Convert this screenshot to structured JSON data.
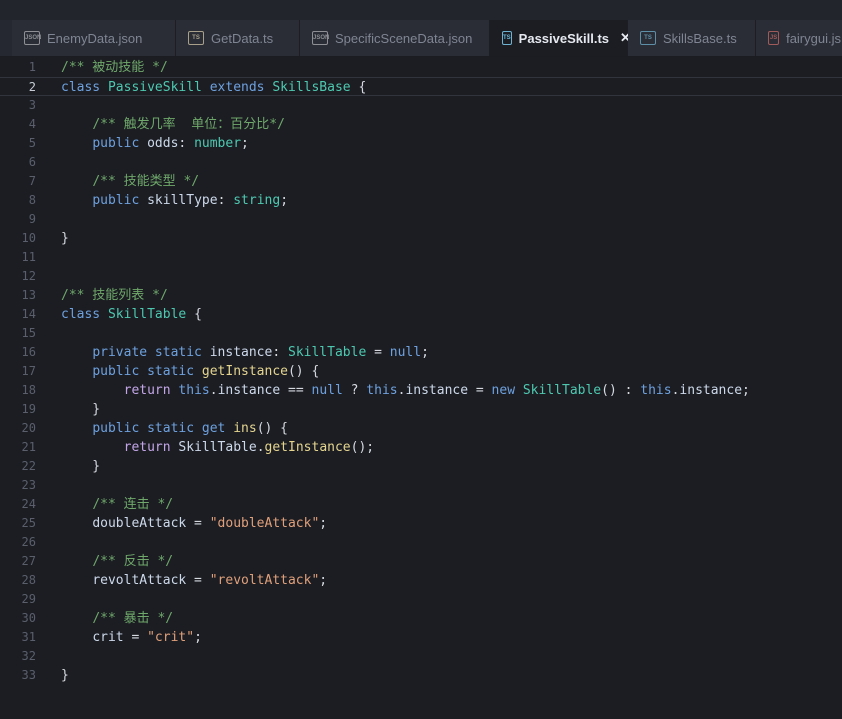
{
  "tabs": [
    {
      "label": "EnemyData.json",
      "icon": "json-file-icon",
      "badge": "JSON",
      "color": "#8d8f95"
    },
    {
      "label": "GetData.ts",
      "icon": "ts-file-icon",
      "badge": "TS",
      "color": "#a8a08a"
    },
    {
      "label": "SpecificSceneData.json",
      "icon": "json-file-icon",
      "badge": "JSON",
      "color": "#8d8f95"
    },
    {
      "label": "PassiveSkill.ts",
      "icon": "ts-file-icon",
      "badge": "TS",
      "color": "#6fb3d2",
      "active": true,
      "close": "✕"
    },
    {
      "label": "SkillsBase.ts",
      "icon": "ts-file-icon",
      "badge": "TS",
      "color": "#5e8fa8"
    },
    {
      "label": "fairygui.js",
      "icon": "js-file-icon",
      "badge": "JS",
      "color": "#a05a5a"
    }
  ],
  "editor": {
    "current_line": 2,
    "lines": [
      {
        "n": "1",
        "tokens": [
          {
            "t": "c",
            "v": "/** 被动技能 */"
          }
        ]
      },
      {
        "n": "2",
        "tokens": [
          {
            "t": "k",
            "v": "class "
          },
          {
            "t": "cls",
            "v": "PassiveSkill "
          },
          {
            "t": "k",
            "v": "extends "
          },
          {
            "t": "cls",
            "v": "SkillsBase "
          },
          {
            "t": "",
            "v": "{"
          }
        ]
      },
      {
        "n": "3",
        "tokens": []
      },
      {
        "n": "4",
        "tokens": [
          {
            "t": "",
            "v": "    "
          },
          {
            "t": "c",
            "v": "/** 触发几率  单位：百分比*/"
          }
        ]
      },
      {
        "n": "5",
        "tokens": [
          {
            "t": "",
            "v": "    "
          },
          {
            "t": "k",
            "v": "public "
          },
          {
            "t": "v",
            "v": "odds"
          },
          {
            "t": "",
            "v": ": "
          },
          {
            "t": "cls",
            "v": "number"
          },
          {
            "t": "",
            "v": ";"
          }
        ]
      },
      {
        "n": "6",
        "tokens": []
      },
      {
        "n": "7",
        "tokens": [
          {
            "t": "",
            "v": "    "
          },
          {
            "t": "c",
            "v": "/** 技能类型 */"
          }
        ]
      },
      {
        "n": "8",
        "tokens": [
          {
            "t": "",
            "v": "    "
          },
          {
            "t": "k",
            "v": "public "
          },
          {
            "t": "v",
            "v": "skillType"
          },
          {
            "t": "",
            "v": ": "
          },
          {
            "t": "cls",
            "v": "string"
          },
          {
            "t": "",
            "v": ";"
          }
        ]
      },
      {
        "n": "9",
        "tokens": []
      },
      {
        "n": "10",
        "tokens": [
          {
            "t": "",
            "v": "}"
          }
        ]
      },
      {
        "n": "11",
        "tokens": []
      },
      {
        "n": "12",
        "tokens": []
      },
      {
        "n": "13",
        "tokens": [
          {
            "t": "c",
            "v": "/** 技能列表 */"
          }
        ]
      },
      {
        "n": "14",
        "tokens": [
          {
            "t": "k",
            "v": "class "
          },
          {
            "t": "cls",
            "v": "SkillTable "
          },
          {
            "t": "",
            "v": "{"
          }
        ]
      },
      {
        "n": "15",
        "tokens": []
      },
      {
        "n": "16",
        "tokens": [
          {
            "t": "",
            "v": "    "
          },
          {
            "t": "k",
            "v": "private static "
          },
          {
            "t": "v",
            "v": "instance"
          },
          {
            "t": "",
            "v": ": "
          },
          {
            "t": "cls",
            "v": "SkillTable"
          },
          {
            "t": "",
            "v": " = "
          },
          {
            "t": "k",
            "v": "null"
          },
          {
            "t": "",
            "v": ";"
          }
        ]
      },
      {
        "n": "17",
        "tokens": [
          {
            "t": "",
            "v": "    "
          },
          {
            "t": "k",
            "v": "public static "
          },
          {
            "t": "fn",
            "v": "getInstance"
          },
          {
            "t": "",
            "v": "() {"
          }
        ]
      },
      {
        "n": "18",
        "tokens": [
          {
            "t": "",
            "v": "        "
          },
          {
            "t": "p",
            "v": "return "
          },
          {
            "t": "k",
            "v": "this"
          },
          {
            "t": "",
            "v": "."
          },
          {
            "t": "v",
            "v": "instance"
          },
          {
            "t": "",
            "v": " == "
          },
          {
            "t": "k",
            "v": "null"
          },
          {
            "t": "",
            "v": " ? "
          },
          {
            "t": "k",
            "v": "this"
          },
          {
            "t": "",
            "v": "."
          },
          {
            "t": "v",
            "v": "instance"
          },
          {
            "t": "",
            "v": " = "
          },
          {
            "t": "k",
            "v": "new "
          },
          {
            "t": "cls",
            "v": "SkillTable"
          },
          {
            "t": "",
            "v": "() : "
          },
          {
            "t": "k",
            "v": "this"
          },
          {
            "t": "",
            "v": "."
          },
          {
            "t": "v",
            "v": "instance"
          },
          {
            "t": "",
            "v": ";"
          }
        ]
      },
      {
        "n": "19",
        "tokens": [
          {
            "t": "",
            "v": "    }"
          }
        ]
      },
      {
        "n": "20",
        "tokens": [
          {
            "t": "",
            "v": "    "
          },
          {
            "t": "k",
            "v": "public static get "
          },
          {
            "t": "fn",
            "v": "ins"
          },
          {
            "t": "",
            "v": "() {"
          }
        ]
      },
      {
        "n": "21",
        "tokens": [
          {
            "t": "",
            "v": "        "
          },
          {
            "t": "p",
            "v": "return "
          },
          {
            "t": "v",
            "v": "SkillTable"
          },
          {
            "t": "",
            "v": "."
          },
          {
            "t": "fn",
            "v": "getInstance"
          },
          {
            "t": "",
            "v": "();"
          }
        ]
      },
      {
        "n": "22",
        "tokens": [
          {
            "t": "",
            "v": "    }"
          }
        ]
      },
      {
        "n": "23",
        "tokens": []
      },
      {
        "n": "24",
        "tokens": [
          {
            "t": "",
            "v": "    "
          },
          {
            "t": "c",
            "v": "/** 连击 */"
          }
        ]
      },
      {
        "n": "25",
        "tokens": [
          {
            "t": "",
            "v": "    "
          },
          {
            "t": "v",
            "v": "doubleAttack"
          },
          {
            "t": "",
            "v": " = "
          },
          {
            "t": "s",
            "v": "\"doubleAttack\""
          },
          {
            "t": "",
            "v": ";"
          }
        ]
      },
      {
        "n": "26",
        "tokens": []
      },
      {
        "n": "27",
        "tokens": [
          {
            "t": "",
            "v": "    "
          },
          {
            "t": "c",
            "v": "/** 反击 */"
          }
        ]
      },
      {
        "n": "28",
        "tokens": [
          {
            "t": "",
            "v": "    "
          },
          {
            "t": "v",
            "v": "revoltAttack"
          },
          {
            "t": "",
            "v": " = "
          },
          {
            "t": "s",
            "v": "\"revoltAttack\""
          },
          {
            "t": "",
            "v": ";"
          }
        ]
      },
      {
        "n": "29",
        "tokens": []
      },
      {
        "n": "30",
        "tokens": [
          {
            "t": "",
            "v": "    "
          },
          {
            "t": "c",
            "v": "/** 暴击 */"
          }
        ]
      },
      {
        "n": "31",
        "tokens": [
          {
            "t": "",
            "v": "    "
          },
          {
            "t": "v",
            "v": "crit"
          },
          {
            "t": "",
            "v": " = "
          },
          {
            "t": "s",
            "v": "\"crit\""
          },
          {
            "t": "",
            "v": ";"
          }
        ]
      },
      {
        "n": "32",
        "tokens": []
      },
      {
        "n": "33",
        "tokens": [
          {
            "t": "",
            "v": "}"
          }
        ]
      }
    ]
  }
}
